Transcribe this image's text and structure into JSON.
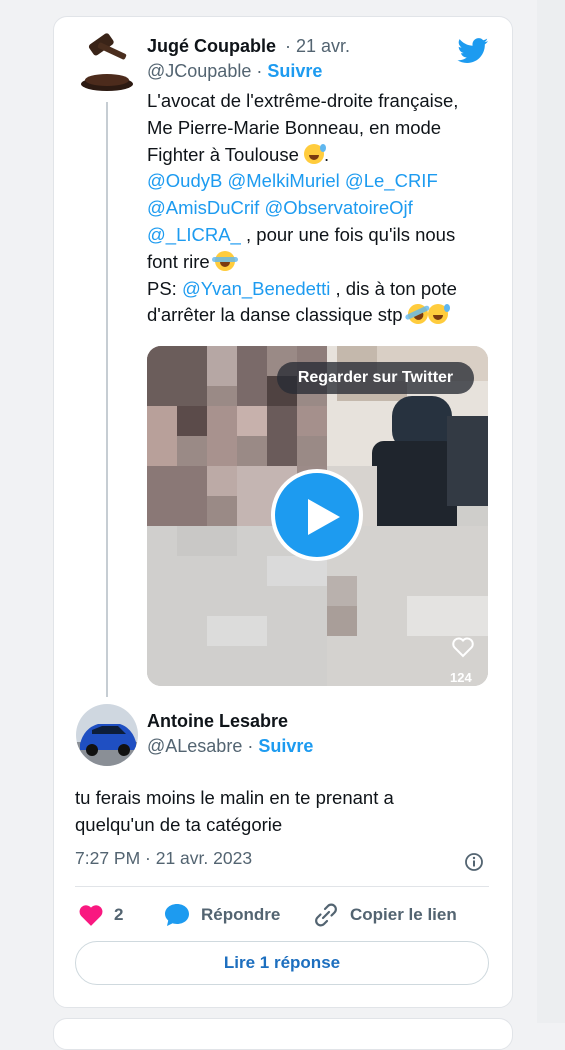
{
  "tweet": {
    "author_name": "Jugé Coupable",
    "date": "21 avr.",
    "handle": "@JCoupable",
    "follow_label": "Suivre",
    "text_line1": "L'avocat de l'extrême-droite française,",
    "text_line2": "Me Pierre-Marie Bonneau, en mode",
    "text_line3": "Fighter à Toulouse",
    "mentions_line1": "@OudyB @MelkiMuriel @Le_CRIF",
    "mentions_line2": "@AmisDuCrif @ObservatoireOjf",
    "mention_licra": "@_LICRA_",
    "text_after_licra": " ,  pour une fois qu'ils nous",
    "text_line_font": "font rire",
    "ps_prefix": "PS: ",
    "ps_mention": "@Yvan_Benedetti",
    "ps_rest": " , dis à ton pote",
    "ps_line2": "d'arrêter la danse classique stp",
    "media": {
      "watch_label": "Regarder sur Twitter",
      "like_count": "124"
    }
  },
  "reply": {
    "author_name": "Antoine Lesabre",
    "handle": "@ALesabre",
    "follow_label": "Suivre",
    "text_line1": "tu ferais moins le malin en te prenant a",
    "text_line2": "quelqu'un de ta catégorie",
    "timestamp": "7:27 PM · 21 avr. 2023",
    "like_count": "2",
    "reply_label": "Répondre",
    "copy_label": "Copier le lien",
    "load_more_label": "Lire 1 réponse"
  },
  "colors": {
    "accent": "#1d9bf0",
    "heart": "#f91880",
    "text": "#0f1419",
    "muted": "#536471"
  }
}
